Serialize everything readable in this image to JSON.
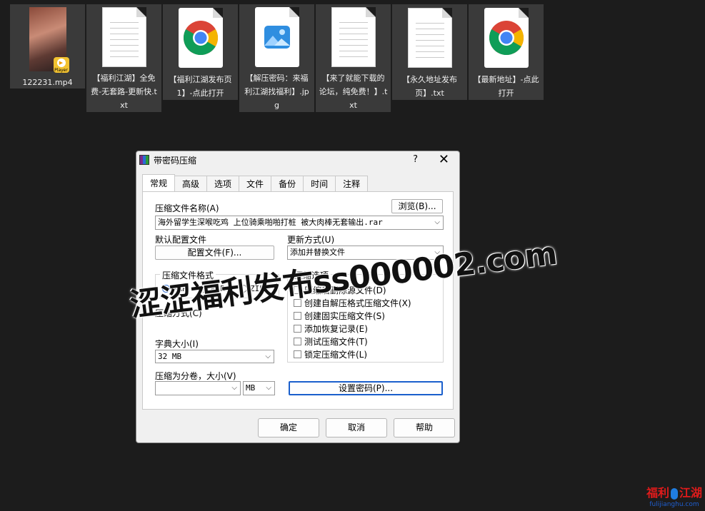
{
  "desktop": {
    "files": [
      {
        "name": "122231.mp4",
        "badge": "Player"
      },
      {
        "name": "【福利江湖】全免费-无套路-更新快.txt"
      },
      {
        "name": "【福利江湖发布页1】-点此打开"
      },
      {
        "name": "【解压密码：来福利江湖找福利】.jpg"
      },
      {
        "name": "【来了就能下载的论坛，纯免费！】.txt"
      },
      {
        "name": "【永久地址发布页】.txt"
      },
      {
        "name": "【最新地址】-点此打开"
      }
    ]
  },
  "dialog": {
    "title": "带密码压缩",
    "help": "?",
    "close": "✕",
    "tabs": [
      "常规",
      "高级",
      "选项",
      "文件",
      "备份",
      "时间",
      "注释"
    ],
    "archive_name_label": "压缩文件名称(A)",
    "browse_button": "浏览(B)...",
    "archive_name_value": "海外留学生深喉吃鸡 上位骑乘啪啪打桩 被大肉棒无套输出.rar",
    "default_profile_label": "默认配置文件",
    "profile_button": "配置文件(F)...",
    "update_mode_label": "更新方式(U)",
    "update_mode_value": "添加并替换文件",
    "format_group_label": "压缩文件格式",
    "formats": [
      "RAR",
      "RAR4",
      "ZIP"
    ],
    "selected_format": "RAR",
    "options_group_label": "压缩选项",
    "options": [
      "压缩后删除源文件(D)",
      "创建自解压格式压缩文件(X)",
      "创建固实压缩文件(S)",
      "添加恢复记录(E)",
      "测试压缩文件(T)",
      "锁定压缩文件(L)"
    ],
    "method_label": "压缩方式(C)",
    "dictionary_label": "字典大小(I)",
    "dictionary_value": "32 MB",
    "split_label": "压缩为分卷，大小(V)",
    "split_value": "",
    "split_unit": "MB",
    "set_password_button": "设置密码(P)...",
    "ok_button": "确定",
    "cancel_button": "取消",
    "help_button": "帮助"
  },
  "watermark": "涩涩福利发布ss000002.com",
  "logo": {
    "text_left": "福利",
    "text_right": "江湖",
    "url": "fulijianghu.com"
  }
}
